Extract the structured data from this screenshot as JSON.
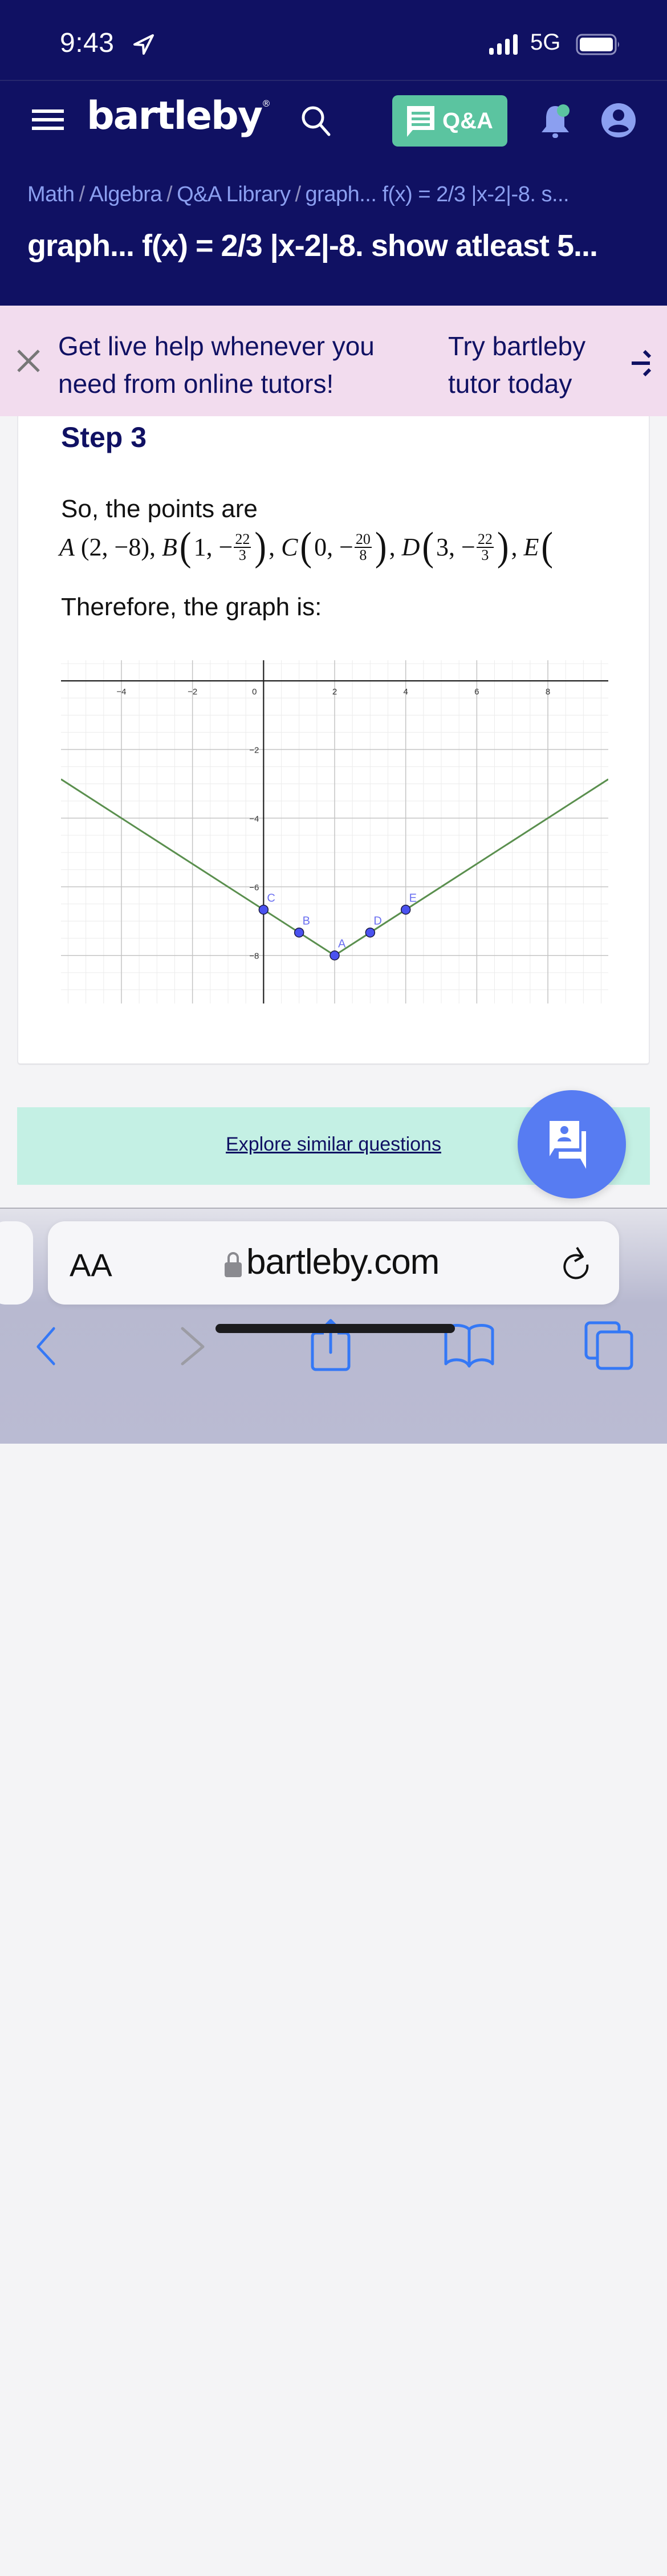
{
  "status_bar": {
    "time": "9:43",
    "network": "5G",
    "icons": [
      "location-arrow-icon",
      "signal-bars-icon",
      "battery-icon"
    ]
  },
  "header": {
    "logo": "bartleby",
    "logo_mark": "®",
    "qa_label": "Q&A",
    "icons": [
      "menu-icon",
      "search-icon",
      "chat-icon",
      "bell-icon",
      "user-icon"
    ],
    "colors": {
      "nav_bg": "#101163",
      "qa_green": "#5bc4a0",
      "accent_blue": "#8b9ff0",
      "notification_dot": "#5bc4a0"
    }
  },
  "breadcrumb": {
    "items": [
      "Math",
      "Algebra",
      "Q&A Library",
      "graph... f(x) = 2/3 |x-2|-8. s..."
    ],
    "separator": "/"
  },
  "page_title": "graph... f(x) = 2/3 |x-2|-8. show atleast 5...",
  "promo": {
    "text_line1": "Get live help whenever you",
    "text_line2": "need from online tutors!",
    "cta_line1": "Try bartleby",
    "cta_line2": "tutor today",
    "bg_color": "#f2dcee"
  },
  "solution": {
    "step_title": "Step 3",
    "intro": "So, the points are",
    "points_text": {
      "A": {
        "label": "A",
        "x": "2",
        "y": "−8"
      },
      "B": {
        "label": "B",
        "x": "1",
        "y_num": "22",
        "y_den": "3"
      },
      "C": {
        "label": "C",
        "x": "0",
        "y_num": "20",
        "y_den": "8"
      },
      "D": {
        "label": "D",
        "x": "3",
        "y_num": "22",
        "y_den": "3"
      },
      "E": {
        "label": "E"
      }
    },
    "conclusion": "Therefore, the graph is:"
  },
  "chart_data": {
    "type": "line",
    "title": "",
    "function": "f(x) = 2/3 |x-2| - 8",
    "xlabel": "",
    "ylabel": "",
    "xlim": [
      -5.7,
      9.7
    ],
    "ylim": [
      -9.4,
      0.6
    ],
    "x_ticks": [
      -4,
      -2,
      0,
      2,
      4,
      6,
      8
    ],
    "y_ticks": [
      -2,
      -4,
      -6,
      -8
    ],
    "grid": true,
    "minor_grid_step": 0.5,
    "line_color": "#5a8f4e",
    "point_color": "#4a52f0",
    "label_color": "#6a6ff0",
    "series": [
      {
        "name": "f(x)",
        "x": [
          -5.7,
          2,
          9.7
        ],
        "y": [
          -2.8667,
          -8,
          -2.8667
        ]
      }
    ],
    "points": [
      {
        "label": "A",
        "x": 2,
        "y": -8
      },
      {
        "label": "B",
        "x": 1,
        "y": -7.333
      },
      {
        "label": "C",
        "x": 0,
        "y": -6.667
      },
      {
        "label": "D",
        "x": 3,
        "y": -7.333
      },
      {
        "label": "E",
        "x": 4,
        "y": -6.667
      }
    ]
  },
  "explore": {
    "label": "Explore similar questions",
    "bg_color": "#c4f0e4"
  },
  "fab": {
    "icon": "tutor-chat-icon",
    "color": "#577cf2"
  },
  "browser": {
    "text_size_label": "AA",
    "url": "bartleby.com",
    "toolbar_icons": [
      "back-icon",
      "forward-icon",
      "share-icon",
      "bookmarks-icon",
      "tabs-icon"
    ],
    "accent": "#3478f6"
  }
}
